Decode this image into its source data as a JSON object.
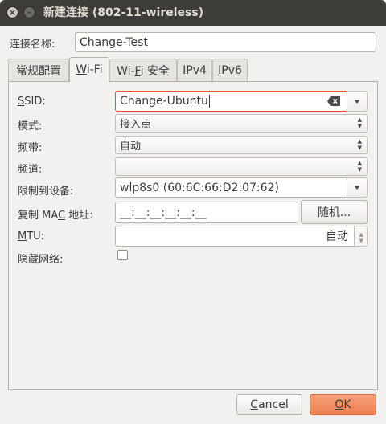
{
  "window": {
    "title": "新建连接 (802-11-wireless)",
    "close_glyph": "×",
    "minimize_glyph": "–"
  },
  "connection_name": {
    "label": "连接名称:",
    "value": "Change-Test"
  },
  "tabs": [
    {
      "label": "常规配置"
    },
    {
      "label_mn": "W",
      "label_rest": "i-Fi"
    },
    {
      "label_pre": "Wi-",
      "label_mn": "F",
      "label_rest": "i 安全"
    },
    {
      "label_mn": "I",
      "label_rest": "Pv4"
    },
    {
      "label_mn": "I",
      "label_rest": "Pv6"
    }
  ],
  "wifi": {
    "ssid": {
      "label_mn": "S",
      "label_rest": "SID:",
      "value": "Change-Ubuntu"
    },
    "mode": {
      "label": "模式:",
      "value": "接入点"
    },
    "band": {
      "label": "频带:",
      "value": "自动"
    },
    "channel": {
      "label": "频道:",
      "value": ""
    },
    "device": {
      "label": "限制到设备:",
      "value": "wlp8s0 (60:6C:66:D2:07:62)"
    },
    "cloned_mac": {
      "label_pre": "复制 MA",
      "label_mn": "C",
      "label_rest": " 地址:",
      "value": "__:__:__:__:__:__",
      "random_button": "随机..."
    },
    "mtu": {
      "label_mn": "M",
      "label_rest": "TU:",
      "value": "自动"
    },
    "hidden": {
      "label": "隐藏网络:",
      "checked": false
    }
  },
  "buttons": {
    "cancel_mn": "C",
    "cancel_rest": "ancel",
    "ok_mn": "O",
    "ok_rest": "K"
  },
  "colors": {
    "titlebar": "#3d3c38",
    "accent": "#e95420",
    "ok_button": "#f08a5d"
  }
}
